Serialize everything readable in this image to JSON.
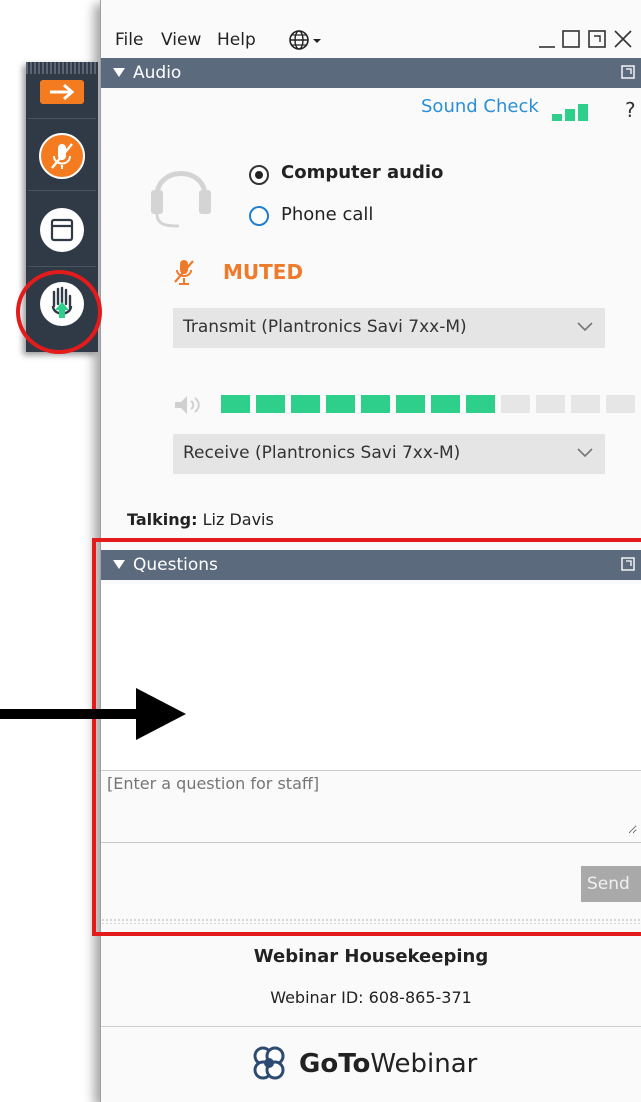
{
  "menu": {
    "items": [
      "File",
      "View",
      "Help"
    ],
    "language_icon": "globe-icon"
  },
  "window_controls": [
    "minimize-icon",
    "maximize-icon",
    "popout-icon",
    "close-icon"
  ],
  "audio_panel": {
    "header": "Audio",
    "sound_check": "Sound Check",
    "help": "?",
    "options": [
      {
        "label": "Computer audio",
        "selected": true
      },
      {
        "label": "Phone call",
        "selected": false
      }
    ],
    "mute_status": "MUTED",
    "transmit_device": "Transmit (Plantronics Savi 7xx-M)",
    "receive_device": "Receive (Plantronics Savi 7xx-M)",
    "output_level": {
      "lit_segments": 8,
      "total_segments": 13
    },
    "talking_label": "Talking:",
    "talking_name": "Liz Davis"
  },
  "questions_panel": {
    "header": "Questions",
    "placeholder": "[Enter a question for staff]",
    "send_label": "Send"
  },
  "footer": {
    "title": "Webinar Housekeeping",
    "webinar_id": "Webinar ID: 608-865-371",
    "brand_bold": "GoTo",
    "brand_regular": "Webinar"
  },
  "toolbar": {
    "buttons": [
      "expand-arrow-icon",
      "mute-microphone-icon",
      "window-icon",
      "raise-hand-icon"
    ]
  },
  "colors": {
    "panel_header": "#5c6a7d",
    "accent_blue": "#2a8fd6",
    "muted_orange": "#ee7a2b",
    "level_green": "#2ecf8b",
    "highlight_red": "#e31b1b",
    "toolbar_bg": "#2f3a46"
  }
}
